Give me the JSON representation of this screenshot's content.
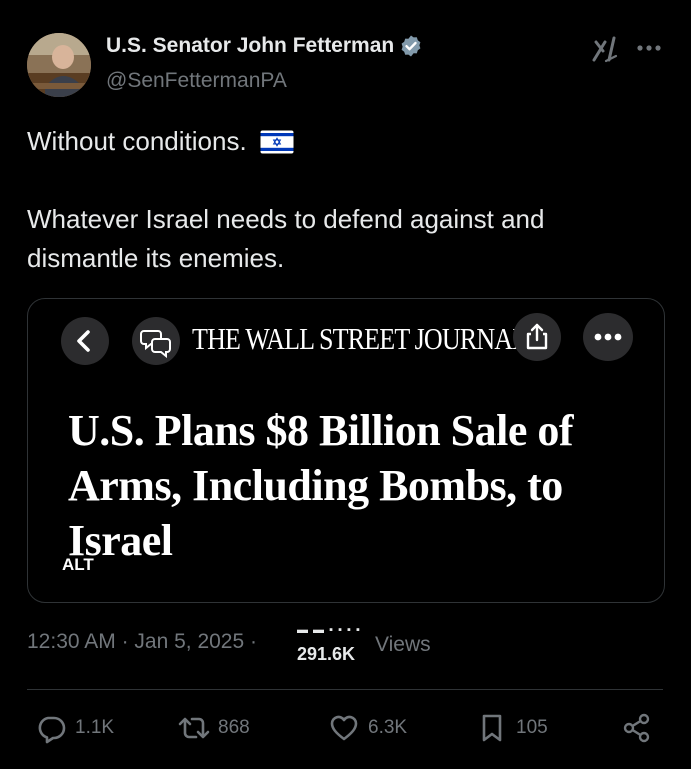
{
  "author": {
    "name": "U.S. Senator John Fetterman",
    "handle": "@SenFettermanPA"
  },
  "tweet": {
    "line1": "Without conditions.",
    "line2": "Whatever Israel needs to defend against and dismantle its enemies."
  },
  "media": {
    "masthead": "THE WALL STREET JOURNAL.",
    "headline": "U.S. Plans $8 Billion Sale of Arms, Including Bombs, to Israel",
    "alt_label": "ALT"
  },
  "meta": {
    "time": "12:30 AM",
    "date": "Jan 5, 2025",
    "views_count": "291.6K",
    "views_label": "Views",
    "views_dots": "▬ ▬ ▪ ▪ ▪ ▪"
  },
  "actions": {
    "replies": "1.1K",
    "reposts": "868",
    "likes": "6.3K",
    "bookmarks": "105"
  },
  "icons": {
    "verified": "verified-badge-icon",
    "grok": "grok-icon",
    "more": "more-icon",
    "flag": "israel-flag-icon",
    "back": "chevron-left-icon",
    "comments": "comments-icon",
    "share": "share-icon",
    "reply": "reply-icon",
    "repost": "repost-icon",
    "like": "heart-icon",
    "bookmark": "bookmark-icon",
    "share_action": "share-nodes-icon"
  },
  "colors": {
    "background": "#000000",
    "text_primary": "#e7e9ea",
    "text_secondary": "#71767b",
    "border": "#2f3336",
    "verified": "#829aab",
    "flag_blue": "#0038b8"
  }
}
